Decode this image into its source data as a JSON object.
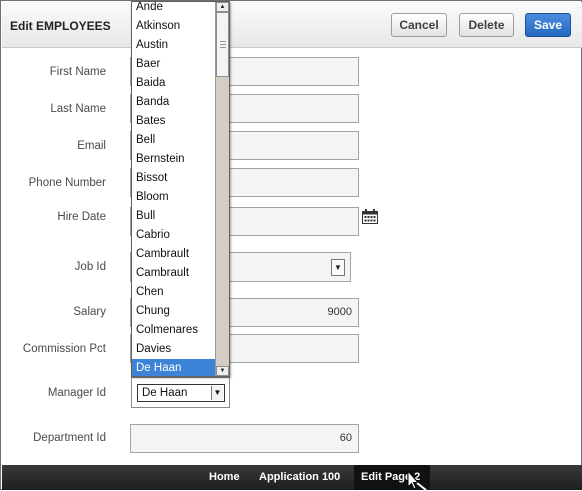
{
  "header": {
    "title": "Edit EMPLOYEES",
    "cancel_label": "Cancel",
    "delete_label": "Delete",
    "save_label": "Save"
  },
  "form": {
    "first_name": {
      "label": "First Name",
      "value": ""
    },
    "last_name": {
      "label": "Last Name",
      "value": ""
    },
    "email": {
      "label": "Email",
      "value": ""
    },
    "phone_number": {
      "label": "Phone Number",
      "value": ""
    },
    "hire_date": {
      "label": "Hire Date",
      "value": ""
    },
    "job_id": {
      "label": "Job Id",
      "value": ""
    },
    "salary": {
      "label": "Salary",
      "value": "9000"
    },
    "commission_pct": {
      "label": "Commission Pct",
      "value": ""
    },
    "manager_id": {
      "label": "Manager Id",
      "value": "De Haan"
    },
    "department_id": {
      "label": "Department Id",
      "value": "60"
    }
  },
  "manager_dropdown": {
    "options": [
      "Ande",
      "Atkinson",
      "Austin",
      "Baer",
      "Baida",
      "Banda",
      "Bates",
      "Bell",
      "Bernstein",
      "Bissot",
      "Bloom",
      "Bull",
      "Cabrio",
      "Cambrault",
      "Cambrault",
      "Chen",
      "Chung",
      "Colmenares",
      "Davies",
      "De Haan"
    ],
    "selected_index": 19,
    "scroll_position": 0.07
  },
  "footer": {
    "home": "Home",
    "application": "Application 100",
    "current": "Edit Page 2"
  },
  "icons": {
    "calendar": "calendar-icon",
    "cursor": "cursor-icon"
  },
  "colors": {
    "save_button": "#2467bf",
    "selected_option": "#3d84d9",
    "footer_bar": "#1e1e1e"
  }
}
